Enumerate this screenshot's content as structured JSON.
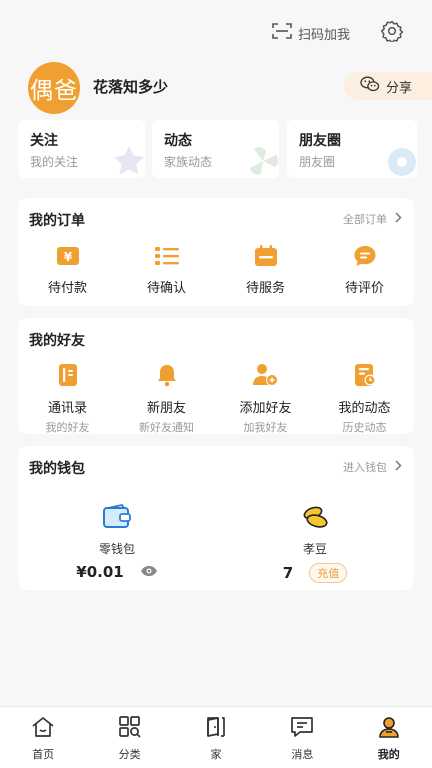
{
  "topbar": {
    "scan_label": "扫码加我"
  },
  "profile": {
    "avatar_text": "偶爸",
    "username": "花落知多少",
    "share_label": "分享"
  },
  "quick_cards": [
    {
      "title": "关注",
      "subtitle": "我的关注"
    },
    {
      "title": "动态",
      "subtitle": "家族动态"
    },
    {
      "title": "朋友圈",
      "subtitle": "朋友圈"
    }
  ],
  "orders": {
    "title": "我的订单",
    "more": "全部订单",
    "items": [
      {
        "label": "待付款",
        "icon": "payment-icon"
      },
      {
        "label": "待确认",
        "icon": "checklist-icon"
      },
      {
        "label": "待服务",
        "icon": "calendar-icon"
      },
      {
        "label": "待评价",
        "icon": "comment-icon"
      }
    ]
  },
  "friends": {
    "title": "我的好友",
    "items": [
      {
        "label": "通讯录",
        "sub": "我的好友",
        "icon": "contacts-icon"
      },
      {
        "label": "新朋友",
        "sub": "新好友通知",
        "icon": "bell-icon"
      },
      {
        "label": "添加好友",
        "sub": "加我好友",
        "icon": "add-friend-icon"
      },
      {
        "label": "我的动态",
        "sub": "历史动态",
        "icon": "moments-icon"
      }
    ]
  },
  "wallet": {
    "title": "我的钱包",
    "more": "进入钱包",
    "change": {
      "label": "零钱包",
      "value": "¥0.01"
    },
    "beans": {
      "label": "孝豆",
      "value": "7",
      "recharge": "充值"
    }
  },
  "nav": [
    {
      "label": "首页",
      "icon": "home-icon"
    },
    {
      "label": "分类",
      "icon": "category-icon"
    },
    {
      "label": "家",
      "icon": "door-icon"
    },
    {
      "label": "消息",
      "icon": "message-icon"
    },
    {
      "label": "我的",
      "icon": "profile-icon"
    }
  ],
  "colors": {
    "accent": "#f0a030",
    "background": "#f7f7f7",
    "card": "#ffffff"
  }
}
